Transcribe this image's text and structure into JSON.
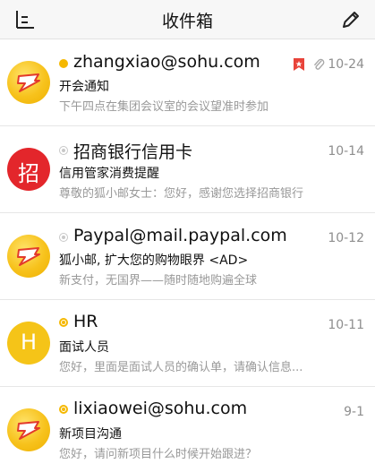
{
  "header": {
    "title": "收件箱",
    "menu_icon": "menu-icon",
    "edit_icon": "compose-icon"
  },
  "colors": {
    "accent": "#f5b800",
    "bank_red": "#e3262b",
    "flag_red": "#e8433a",
    "muted": "#999999"
  },
  "messages": [
    {
      "sender": "zhangxiao@sohu.com",
      "subject": "开会通知",
      "preview": "下午四点在集团会议室的会议望准时参加",
      "date": "10-24",
      "status": "unread",
      "flagged": true,
      "attachment": true,
      "avatar": "fox-logo"
    },
    {
      "sender": "招商银行信用卡",
      "subject": "信用管家消费提醒",
      "preview": "尊敬的狐小邮女士：您好，感谢您选择招商银行",
      "date": "10-14",
      "status": "read",
      "avatar_text": "招"
    },
    {
      "sender": "Paypal@mail.paypal.com",
      "subject": "狐小邮, 扩大您的购物眼界 <AD>",
      "preview": "新支付，无国界——随时随地购遍全球",
      "date": "10-12",
      "status": "read",
      "avatar": "fox-logo"
    },
    {
      "sender": "HR",
      "subject": "面试人员",
      "preview": "您好，里面是面试人员的确认单，请确认信息...",
      "date": "10-11",
      "status": "replied",
      "avatar_text": "H"
    },
    {
      "sender": "lixiaowei@sohu.com",
      "subject": "新项目沟通",
      "preview": "您好，请问新项目什么时候开始跟进？",
      "date": "9-1",
      "status": "replied",
      "avatar": "fox-logo"
    }
  ]
}
